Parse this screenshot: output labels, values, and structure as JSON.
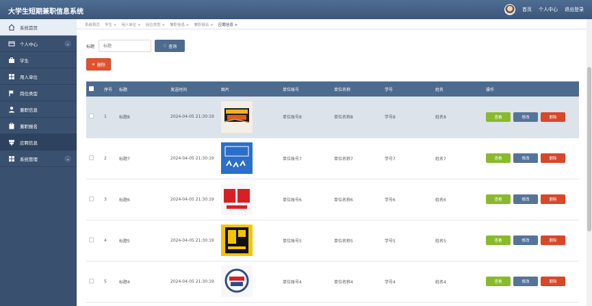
{
  "app": {
    "title": "大学生短期兼职信息系统"
  },
  "topnav": {
    "home": "首页",
    "profile": "个人中心",
    "logout": "退出登录"
  },
  "sidebar": {
    "items": [
      {
        "label": "系统首页",
        "icon": "home-icon"
      },
      {
        "label": "个人中心",
        "icon": "id-card-icon",
        "expand": true
      },
      {
        "label": "学生",
        "icon": "briefcase-icon"
      },
      {
        "label": "用人单位",
        "icon": "grid-icon"
      },
      {
        "label": "岗位类型",
        "icon": "flag-icon"
      },
      {
        "label": "兼职信息",
        "icon": "user-icon"
      },
      {
        "label": "兼职报名",
        "icon": "clipboard-icon"
      },
      {
        "label": "应聘信息",
        "icon": "signpost-icon",
        "active": true
      },
      {
        "label": "系统管理",
        "icon": "grid-icon",
        "expand": true
      }
    ]
  },
  "breadcrumb": [
    "系统首页",
    "学生 ×",
    "用人单位 ×",
    "岗位类型 ×",
    "兼职信息 ×",
    "兼职报名 ×",
    "应聘信息 ×"
  ],
  "search": {
    "label": "标题",
    "placeholder": "标题",
    "button": "查询"
  },
  "toolbar": {
    "delete": "删除"
  },
  "table": {
    "headers": [
      "序号",
      "标题",
      "发送时间",
      "图片",
      "单位账号",
      "单位名称",
      "学号",
      "姓名",
      "操作"
    ],
    "actions": {
      "view": "查看",
      "edit": "修改",
      "delete": "删除"
    },
    "rows": [
      {
        "index": "1",
        "title": "标题8",
        "time": "2024-04-05 21:30:19",
        "unit_account": "单位账号8",
        "unit_name": "单位名称8",
        "student_no": "学号8",
        "name": "姓名8",
        "selected": true
      },
      {
        "index": "2",
        "title": "标题7",
        "time": "2024-04-05 21:30:19",
        "unit_account": "单位账号7",
        "unit_name": "单位名称7",
        "student_no": "学号7",
        "name": "姓名7"
      },
      {
        "index": "3",
        "title": "标题6",
        "time": "2024-04-05 21:30:19",
        "unit_account": "单位账号6",
        "unit_name": "单位名称6",
        "student_no": "学号6",
        "name": "姓名6"
      },
      {
        "index": "4",
        "title": "标题5",
        "time": "2024-04-05 21:30:19",
        "unit_account": "单位账号5",
        "unit_name": "单位名称5",
        "student_no": "学号5",
        "name": "姓名5"
      },
      {
        "index": "5",
        "title": "标题4",
        "time": "2024-04-05 21:30:19",
        "unit_account": "单位账号4",
        "unit_name": "单位名称4",
        "student_no": "学号4",
        "name": "姓名4"
      }
    ]
  },
  "colors": {
    "header": "#4d6a8f",
    "sidebar": "#39506f",
    "view": "#89ba2b",
    "edit": "#56749a",
    "delete": "#d9472a"
  }
}
